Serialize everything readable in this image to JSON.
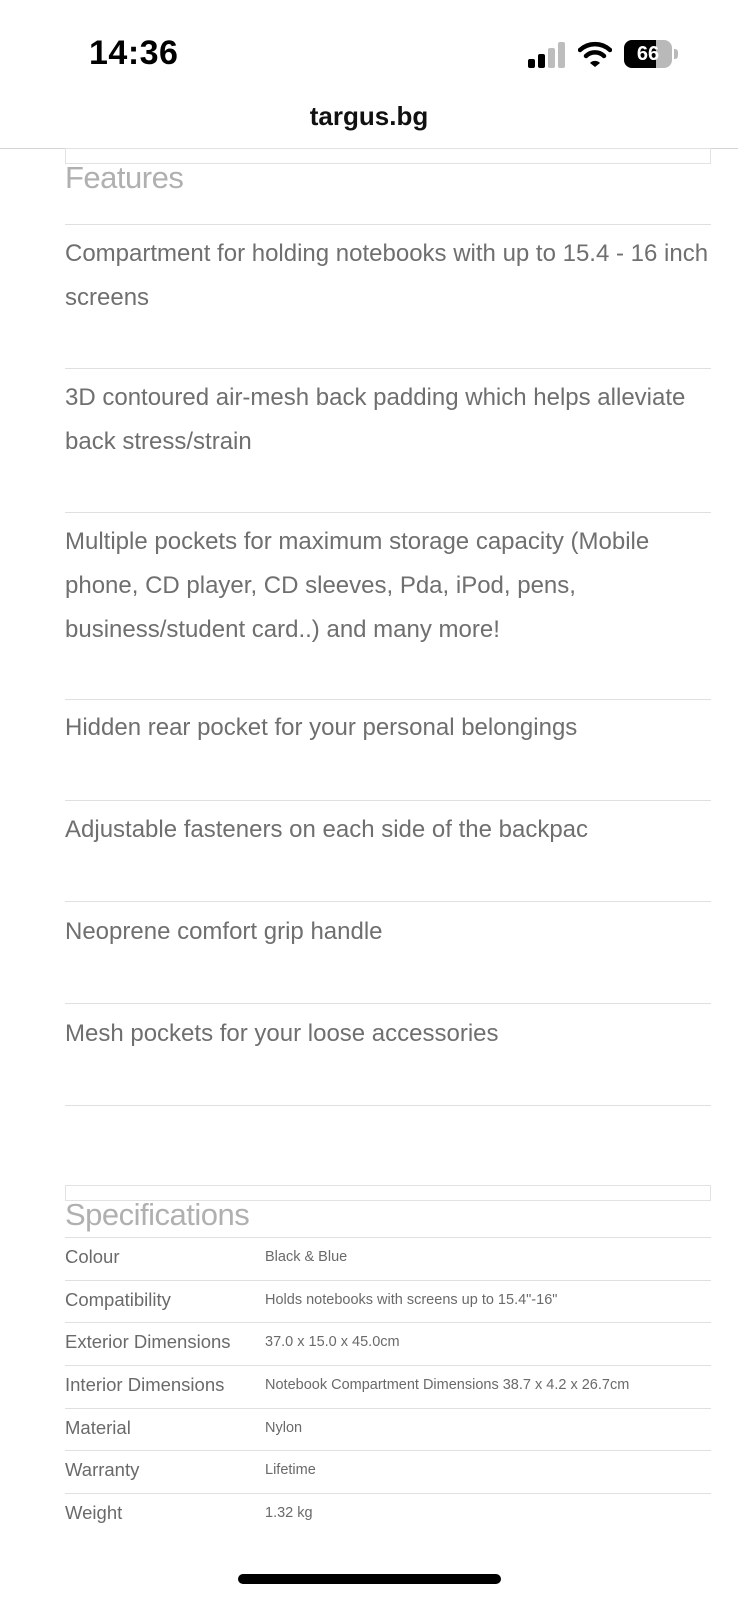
{
  "status_bar": {
    "time": "14:36",
    "battery_level": "66",
    "battery_fraction": 0.66,
    "icons": [
      "cellular-signal-icon",
      "wifi-icon",
      "battery-icon"
    ]
  },
  "browser": {
    "url": "targus.bg"
  },
  "features": {
    "title": "Features",
    "items": [
      "Compartment for holding notebooks with up to 15.4 - 16 inch screens",
      "3D contoured air-mesh back padding which helps alleviate back stress/strain",
      "Multiple pockets for maximum storage capacity (Mobile phone, CD player, CD sleeves, Pda, iPod, pens, business/student card..) and many more!",
      "Hidden rear pocket for your personal belongings",
      "Adjustable fasteners on each side of the backpac",
      "Neoprene comfort grip handle",
      "Mesh pockets for your loose accessories"
    ]
  },
  "specifications": {
    "title": "Specifications",
    "rows": [
      {
        "label": "Colour",
        "value": "Black & Blue"
      },
      {
        "label": "Compatibility",
        "value": "Holds notebooks with screens up to 15.4\"-16\""
      },
      {
        "label": "Exterior Dimensions",
        "value": "37.0 x 15.0 x 45.0cm"
      },
      {
        "label": "Interior Dimensions",
        "value": "Notebook Compartment Dimensions 38.7 x 4.2 x 26.7cm"
      },
      {
        "label": "Material",
        "value": "Nylon"
      },
      {
        "label": "Warranty",
        "value": "Lifetime"
      },
      {
        "label": "Weight",
        "value": "1.32 kg"
      }
    ]
  }
}
